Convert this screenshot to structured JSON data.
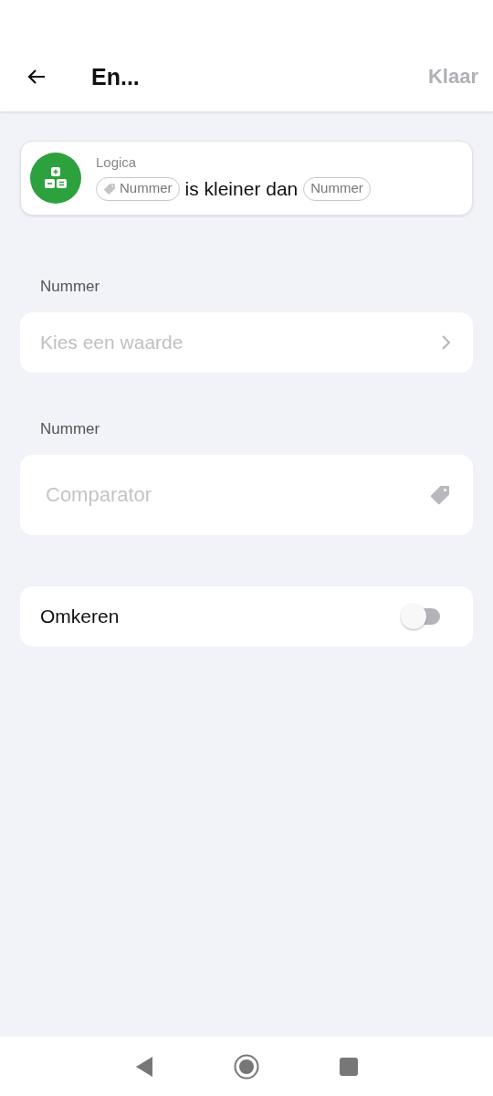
{
  "header": {
    "title": "En...",
    "done": "Klaar"
  },
  "card": {
    "category": "Logica",
    "token_left": "Nummer",
    "text": "is kleiner dan",
    "token_right": "Nummer"
  },
  "fields": [
    {
      "kind": "select",
      "label": "Nummer",
      "placeholder": "Kies een waarde"
    },
    {
      "kind": "tag",
      "label": "Nummer",
      "placeholder": "Comparator"
    }
  ],
  "toggle": {
    "label": "Omkeren",
    "on": false
  }
}
